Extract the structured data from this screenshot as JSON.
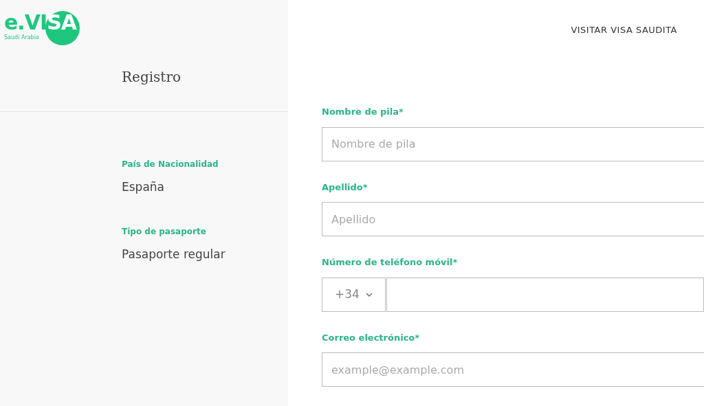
{
  "logo": {
    "mark_left": "e.VI",
    "mark_right": "SA",
    "subtitle": "Saudi Arabia"
  },
  "nav": {
    "link": "VISITAR VISA SAUDITA"
  },
  "sidebar": {
    "title": "Registro",
    "summary": [
      {
        "label": "País de Nacionalidad",
        "value": "España"
      },
      {
        "label": "Tipo de pasaporte",
        "value": "Pasaporte regular"
      }
    ]
  },
  "form": {
    "fields": [
      {
        "kind": "text",
        "label": "Nombre de pila*",
        "placeholder": "Nombre de pila"
      },
      {
        "kind": "text",
        "label": "Apellido*",
        "placeholder": "Apellido"
      },
      {
        "kind": "phone",
        "label": "Número de teléfono móvil*",
        "code": "+34"
      },
      {
        "kind": "text",
        "label": "Correo electrónico*",
        "placeholder": "example@example.com"
      }
    ]
  }
}
